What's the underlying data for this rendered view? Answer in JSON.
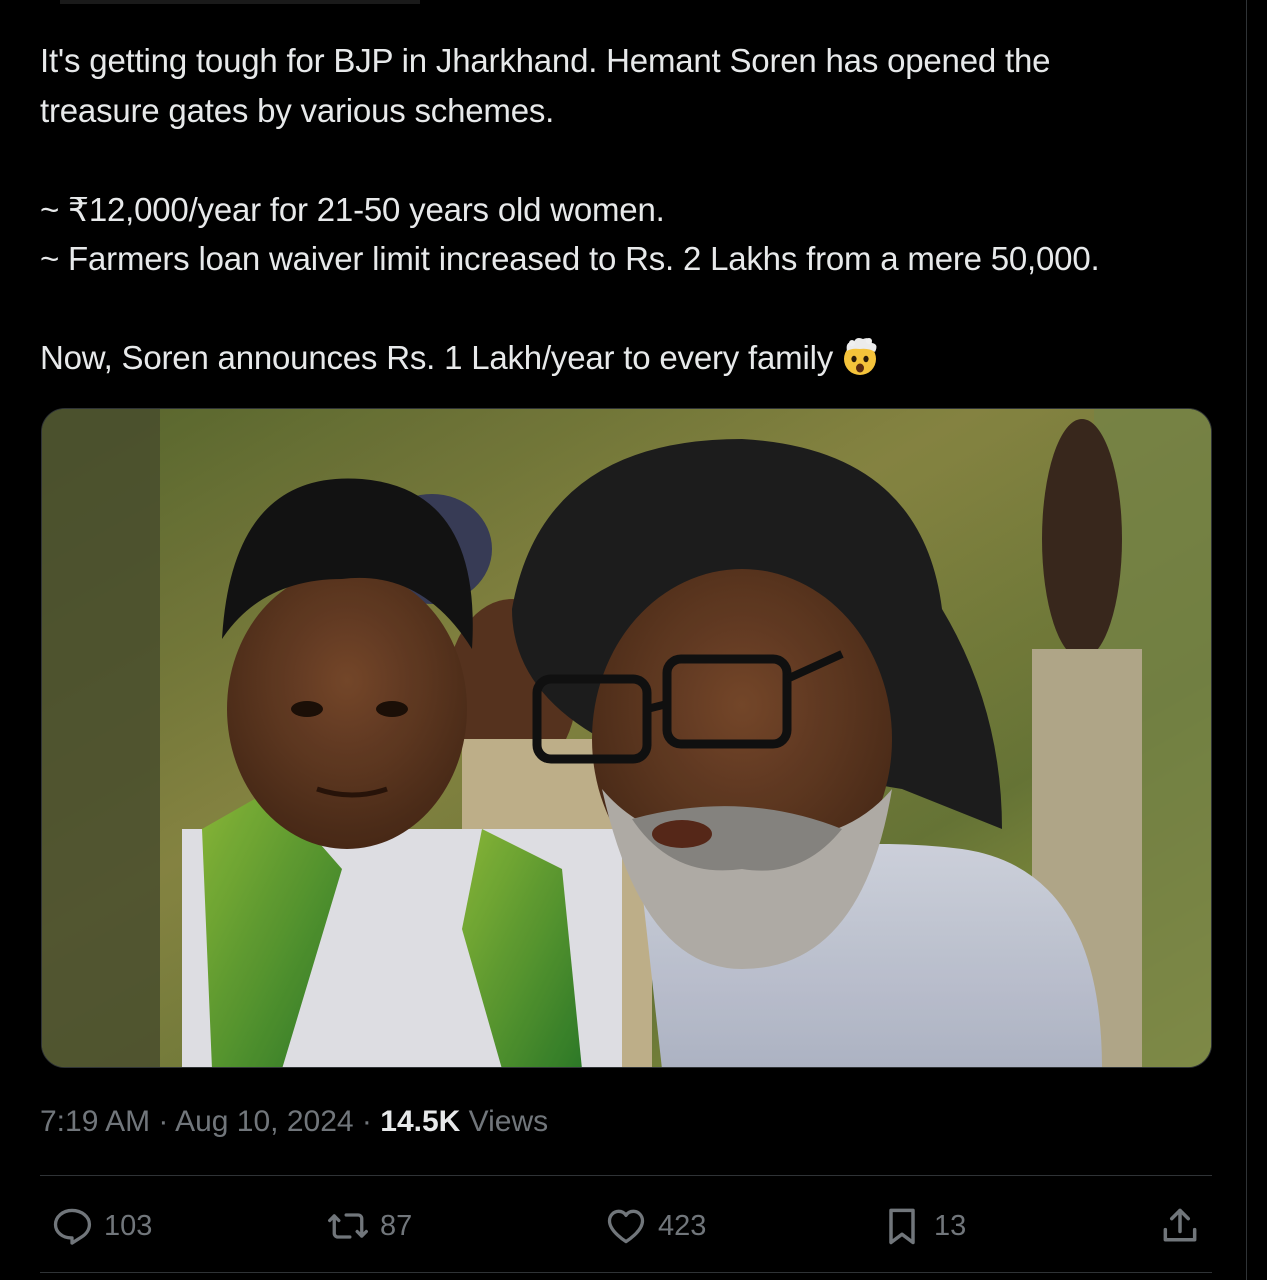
{
  "tweet": {
    "lines": [
      "It's getting tough for BJP in Jharkhand. Hemant Soren has opened the",
      "treasure gates by various schemes.",
      "",
      "~ ₹12,000/year for 21-50 years old women.",
      "~ Farmers loan waiver limit increased to Rs. 2 Lakhs from a mere 50,000.",
      "",
      "Now, Soren announces Rs. 1 Lakh/year to every family"
    ],
    "emoji": "exploding-head-emoji"
  },
  "meta": {
    "time": "7:19 AM",
    "sep1": " · ",
    "date": "Aug 10, 2024",
    "sep2": " · ",
    "views_count": "14.5K",
    "views_label": " Views"
  },
  "actions": {
    "replies": {
      "icon": "reply-icon",
      "count": "103"
    },
    "reposts": {
      "icon": "repost-icon",
      "count": "87"
    },
    "likes": {
      "icon": "heart-icon",
      "count": "423"
    },
    "bookmarks": {
      "icon": "bookmark-icon",
      "count": "13"
    },
    "share": {
      "icon": "share-icon"
    }
  },
  "colors": {
    "background": "#000000",
    "text": "#e7e9ea",
    "muted": "#71767b",
    "border": "#2f3336"
  }
}
